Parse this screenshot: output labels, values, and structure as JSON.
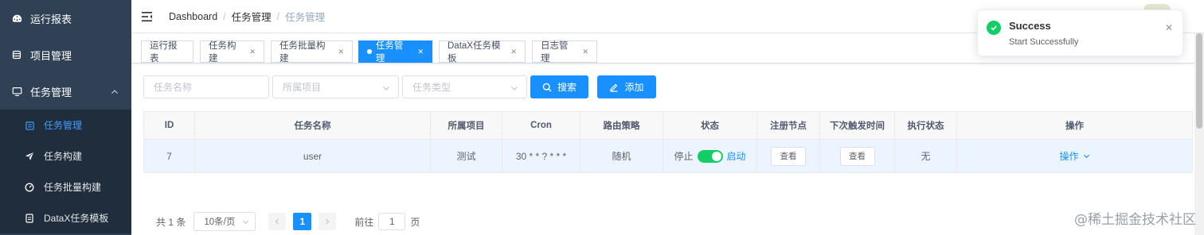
{
  "sidebar": {
    "items": [
      {
        "label": "运行报表",
        "icon": "dashboard-icon"
      },
      {
        "label": "项目管理",
        "icon": "database-icon"
      },
      {
        "label": "任务管理",
        "icon": "monitor-icon"
      }
    ],
    "subitems": [
      {
        "label": "任务管理",
        "icon": "calendar-icon",
        "active": true
      },
      {
        "label": "任务构建",
        "icon": "send-icon"
      },
      {
        "label": "任务批量构建",
        "icon": "gauge-icon"
      },
      {
        "label": "DataX任务模板",
        "icon": "document-icon"
      }
    ]
  },
  "header": {
    "breadcrumb": [
      "Dashboard",
      "任务管理",
      "任务管理"
    ]
  },
  "tags": [
    {
      "label": "运行报表"
    },
    {
      "label": "任务构建"
    },
    {
      "label": "任务批量构建"
    },
    {
      "label": "任务管理"
    },
    {
      "label": "DataX任务模板"
    },
    {
      "label": "日志管理"
    }
  ],
  "filters": {
    "task_name_placeholder": "任务名称",
    "project_placeholder": "所属项目",
    "task_type_placeholder": "任务类型",
    "search_label": "搜索",
    "add_label": "添加"
  },
  "table": {
    "columns": [
      "ID",
      "任务名称",
      "所属项目",
      "Cron",
      "路由策略",
      "状态",
      "注册节点",
      "下次触发时间",
      "执行状态",
      "操作"
    ],
    "rows": [
      {
        "id": "7",
        "name": "user",
        "project": "测试",
        "cron": "30 * * ? * * *",
        "route": "随机",
        "status_off": "停止",
        "status_on": "启动",
        "status_enabled": true,
        "node_btn": "查看",
        "next_btn": "查看",
        "exec_status": "无",
        "op_label": "操作"
      }
    ]
  },
  "pagination": {
    "total": "共 1 条",
    "page_size": "10条/页",
    "current": "1",
    "goto_prefix": "前往",
    "goto_value": "1",
    "goto_suffix": "页"
  },
  "toast": {
    "title": "Success",
    "message": "Start Successfully"
  },
  "watermark": "@稀土掘金技术社区",
  "colors": {
    "sidebar_bg": "#304156",
    "submenu_bg": "#1f2d3d",
    "primary": "#1890ff",
    "success": "#13ce66"
  }
}
